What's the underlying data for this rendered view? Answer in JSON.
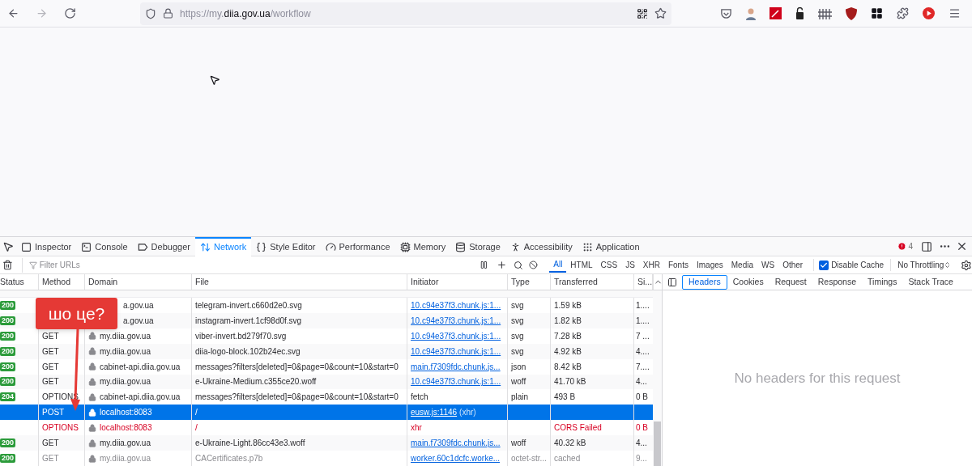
{
  "browser": {
    "nav": [
      {
        "kind": "back",
        "disabled": false
      },
      {
        "kind": "forward",
        "disabled": true
      },
      {
        "kind": "reload",
        "disabled": false
      }
    ],
    "url": {
      "prefix": "https://my.",
      "domain": "diia.gov.ua",
      "path": "/workflow"
    }
  },
  "devtools": {
    "tabs": [
      {
        "kind": "inspector",
        "label": "Inspector",
        "selected": false
      },
      {
        "kind": "console",
        "label": "Console",
        "selected": false
      },
      {
        "kind": "debugger",
        "label": "Debugger",
        "selected": false
      },
      {
        "kind": "network",
        "label": "Network",
        "selected": true
      },
      {
        "kind": "style",
        "label": "Style Editor",
        "selected": false
      },
      {
        "kind": "performance",
        "label": "Performance",
        "selected": false
      },
      {
        "kind": "memory",
        "label": "Memory",
        "selected": false
      },
      {
        "kind": "storage",
        "label": "Storage",
        "selected": false
      },
      {
        "kind": "accessibility",
        "label": "Accessibility",
        "selected": false
      },
      {
        "kind": "application",
        "label": "Application",
        "selected": false
      }
    ],
    "error_count": "4",
    "filter": {
      "placeholder": "Filter URLs"
    },
    "type_filters": [
      {
        "label": "All",
        "selected": true
      },
      {
        "label": "HTML",
        "selected": false
      },
      {
        "label": "CSS",
        "selected": false
      },
      {
        "label": "JS",
        "selected": false
      },
      {
        "label": "XHR",
        "selected": false
      },
      {
        "label": "Fonts",
        "selected": false
      },
      {
        "label": "Images",
        "selected": false
      },
      {
        "label": "Media",
        "selected": false
      },
      {
        "label": "WS",
        "selected": false
      },
      {
        "label": "Other",
        "selected": false
      }
    ],
    "disable_cache": {
      "label": "Disable Cache",
      "checked": true
    },
    "throttling": "No Throttling",
    "columns": [
      "Status",
      "Method",
      "Domain",
      "File",
      "Initiator",
      "Type",
      "Transferred",
      "Si..."
    ],
    "rows": [
      {
        "status": "200",
        "method": "",
        "domain": "a.gov.ua",
        "file": "telegram-invert.c660d2e0.svg",
        "initiator": "10.c94e37f3.chunk.js:1...",
        "initiator_link": true,
        "type": "svg",
        "transferred": "1.59 kB",
        "size": "1....",
        "selected": false,
        "failed": false,
        "dimmed": false,
        "covered": true
      },
      {
        "status": "200",
        "method": "",
        "domain": "a.gov.ua",
        "file": "instagram-invert.1cf98d0f.svg",
        "initiator": "10.c94e37f3.chunk.js:1...",
        "initiator_link": true,
        "type": "svg",
        "transferred": "1.82 kB",
        "size": "1....",
        "selected": false,
        "failed": false,
        "dimmed": false,
        "covered": true
      },
      {
        "status": "200",
        "method": "GET",
        "domain": "my.diia.gov.ua",
        "file": "viber-invert.bd279f70.svg",
        "initiator": "10.c94e37f3.chunk.js:1...",
        "initiator_link": true,
        "type": "svg",
        "transferred": "7.28 kB",
        "size": "7 ...",
        "selected": false,
        "failed": false,
        "dimmed": false,
        "covered": false
      },
      {
        "status": "200",
        "method": "GET",
        "domain": "my.diia.gov.ua",
        "file": "diia-logo-block.102b24ec.svg",
        "initiator": "10.c94e37f3.chunk.js:1...",
        "initiator_link": true,
        "type": "svg",
        "transferred": "4.92 kB",
        "size": "4....",
        "selected": false,
        "failed": false,
        "dimmed": false,
        "covered": false
      },
      {
        "status": "200",
        "method": "GET",
        "domain": "cabinet-api.diia.gov.ua",
        "file": "messages?filters[deleted]=0&page=0&count=10&start=0",
        "initiator": "main.f7309fdc.chunk.js...",
        "initiator_link": true,
        "type": "json",
        "transferred": "8.42 kB",
        "size": "7....",
        "selected": false,
        "failed": false,
        "dimmed": false,
        "covered": false
      },
      {
        "status": "200",
        "method": "GET",
        "domain": "my.diia.gov.ua",
        "file": "e-Ukraine-Medium.c355ce20.woff",
        "initiator": "10.c94e37f3.chunk.js:1...",
        "initiator_link": true,
        "type": "woff",
        "transferred": "41.70 kB",
        "size": "4...",
        "selected": false,
        "failed": false,
        "dimmed": false,
        "covered": false
      },
      {
        "status": "204",
        "method": "OPTIONS",
        "domain": "cabinet-api.diia.gov.ua",
        "file": "messages?filters[deleted]=0&page=0&count=10&start=0",
        "initiator": "fetch",
        "initiator_link": false,
        "type": "plain",
        "transferred": "493 B",
        "size": "0 B",
        "selected": false,
        "failed": false,
        "dimmed": false,
        "covered": false
      },
      {
        "method": "POST",
        "domain": "localhost:8083",
        "file": "/",
        "initiator": "eusw.js:1146",
        "initiator_link": true,
        "initiator_note": "(xhr)",
        "selected": true,
        "failed": false,
        "dimmed": false,
        "covered": false
      },
      {
        "method": "OPTIONS",
        "domain": "localhost:8083",
        "file": "/",
        "initiator": "xhr",
        "initiator_link": false,
        "transferred": "CORS Failed",
        "size": "0 B",
        "selected": false,
        "failed": true,
        "dimmed": false,
        "covered": false
      },
      {
        "status": "200",
        "method": "GET",
        "domain": "my.diia.gov.ua",
        "file": "e-Ukraine-Light.86cc43e3.woff",
        "initiator": "main.f7309fdc.chunk.js...",
        "initiator_link": true,
        "type": "woff",
        "transferred": "40.32 kB",
        "size": "4...",
        "selected": false,
        "failed": false,
        "dimmed": false,
        "covered": false
      },
      {
        "status": "200",
        "method": "GET",
        "domain": "my.diia.gov.ua",
        "file": "CACertificates.p7b",
        "initiator": "worker.60c1dcfc.worke...",
        "initiator_link": true,
        "type": "octet-str...",
        "transferred": "cached",
        "size": "9...",
        "selected": false,
        "failed": false,
        "dimmed": true,
        "covered": false
      }
    ],
    "panel_tabs": [
      {
        "label": "Headers",
        "selected": true
      },
      {
        "label": "Cookies",
        "selected": false
      },
      {
        "label": "Request",
        "selected": false
      },
      {
        "label": "Response",
        "selected": false
      },
      {
        "label": "Timings",
        "selected": false
      },
      {
        "label": "Stack Trace",
        "selected": false
      }
    ],
    "empty_message": "No headers for this request"
  },
  "annotation": {
    "text": "шо це?"
  }
}
